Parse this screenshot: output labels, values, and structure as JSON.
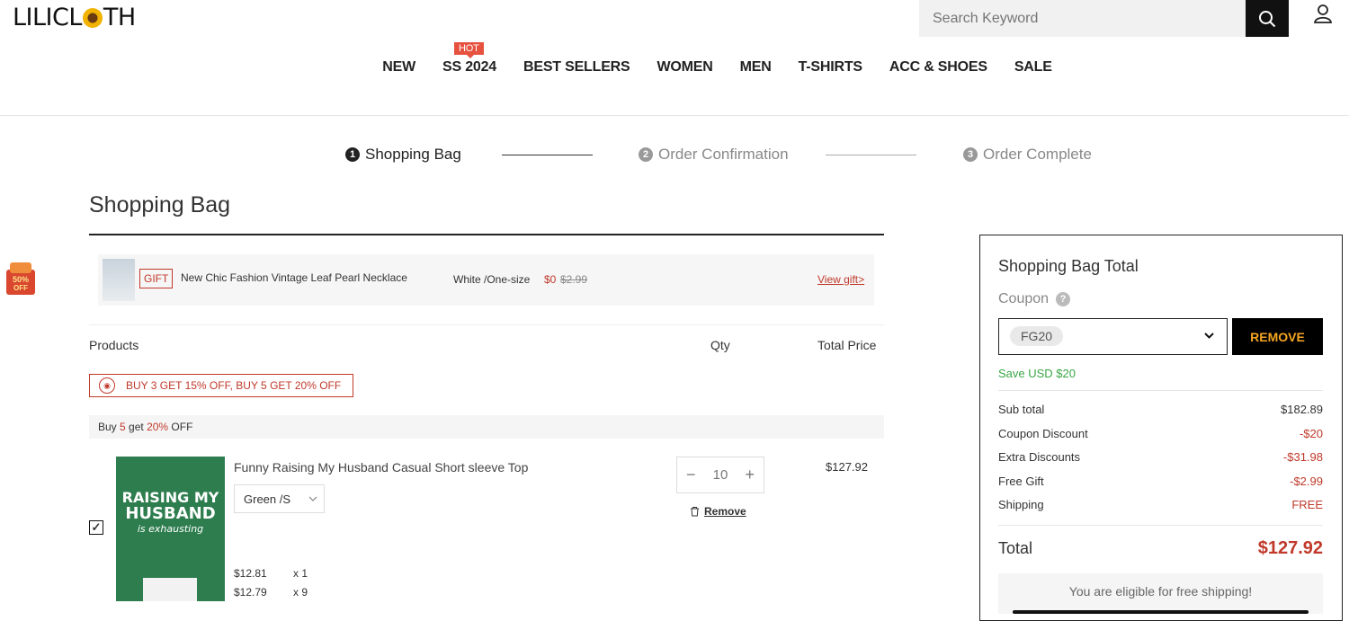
{
  "header": {
    "logo_left": "LILICL",
    "logo_right": "TH",
    "search_placeholder": "Search Keyword"
  },
  "nav": {
    "items": [
      "NEW",
      "SS 2024",
      "BEST SELLERS",
      "WOMEN",
      "MEN",
      "T-SHIRTS",
      "ACC & SHOES",
      "SALE"
    ],
    "hot_badge": "HOT"
  },
  "steps": [
    {
      "num": "1",
      "label": "Shopping Bag",
      "active": true
    },
    {
      "num": "2",
      "label": "Order Confirmation",
      "active": false
    },
    {
      "num": "3",
      "label": "Order Complete",
      "active": false
    }
  ],
  "side_badge": "50% OFF",
  "main": {
    "title": "Shopping Bag",
    "gift": {
      "tag": "GIFT",
      "name": "New Chic Fashion Vintage Leaf Pearl Necklace",
      "variant": "White /One-size",
      "price": "$0",
      "old_price": "$2.99",
      "link": "View gift>"
    },
    "columns": {
      "products": "Products",
      "qty": "Qty",
      "total": "Total Price"
    },
    "promo": "BUY 3 GET 15% OFF, BUY 5 GET 20% OFF",
    "buy_bar": {
      "pre": "Buy ",
      "n": "5",
      "mid": " get ",
      "pct": "20%",
      "post": " OFF"
    },
    "product": {
      "image_text_1": "RAISING MY",
      "image_text_2": "HUSBAND",
      "image_text_3": "is exhausting",
      "name": "Funny Raising My Husband Casual Short sleeve Top",
      "variant": "Green /S",
      "qty": "10",
      "total": "$127.92",
      "remove": "Remove",
      "price_lines": [
        {
          "price": "$12.81",
          "count": "x 1"
        },
        {
          "price": "$12.79",
          "count": "x 9"
        }
      ],
      "checked": true
    }
  },
  "summary": {
    "title": "Shopping Bag Total",
    "coupon_label": "Coupon",
    "coupon_code": "FG20",
    "remove_label": "REMOVE",
    "save_text": "Save USD $20",
    "rows": [
      {
        "label": "Sub total",
        "value": "$182.89"
      },
      {
        "label": "Coupon Discount",
        "value": "-$20"
      },
      {
        "label": "Extra Discounts",
        "value": "-$31.98"
      },
      {
        "label": "Free Gift",
        "value": "-$2.99"
      },
      {
        "label": "Shipping",
        "value": "FREE"
      }
    ],
    "total_label": "Total",
    "total_value": "$127.92",
    "shipping_note": "You are eligible for free shipping!"
  },
  "colors": {
    "accent_red": "#c0392b",
    "hot_red": "#e6523f",
    "save_green": "#3aa646",
    "remove_text": "#f5a623"
  }
}
